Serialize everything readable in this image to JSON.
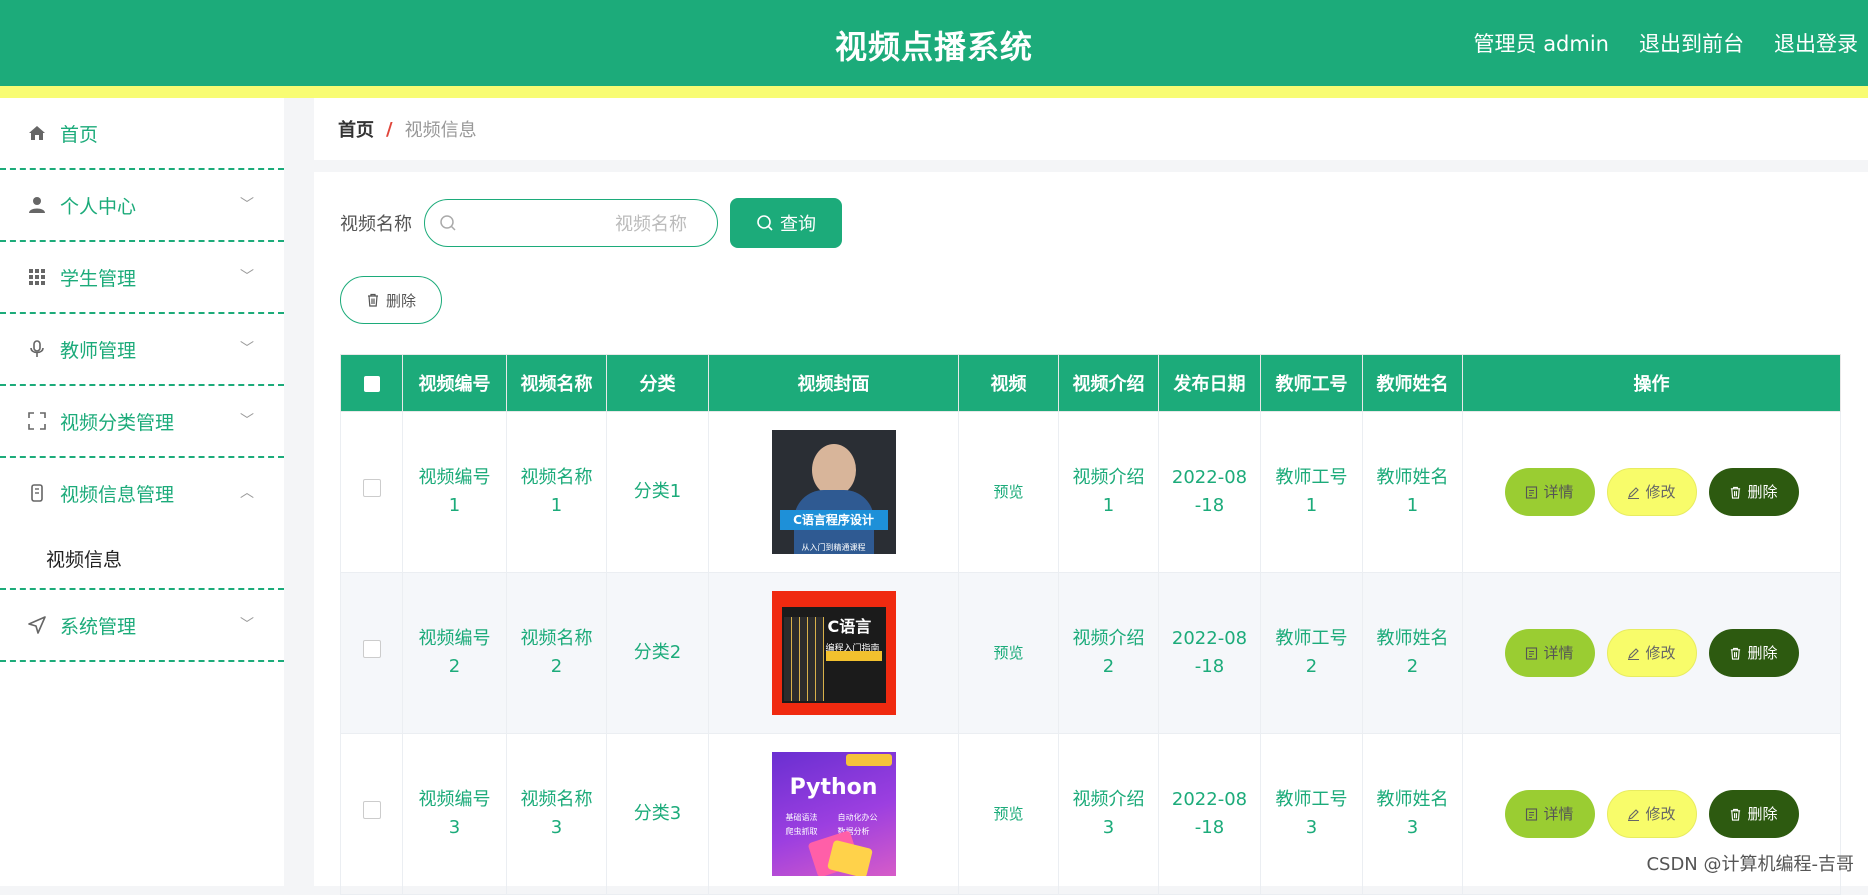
{
  "header": {
    "title": "视频点播系统",
    "user": "管理员 admin",
    "to_front": "退出到前台",
    "logout": "退出登录"
  },
  "sidebar": {
    "items": [
      {
        "label": "首页",
        "icon": "home-icon"
      },
      {
        "label": "个人中心",
        "icon": "user-icon"
      },
      {
        "label": "学生管理",
        "icon": "grid-icon"
      },
      {
        "label": "教师管理",
        "icon": "microphone-icon"
      },
      {
        "label": "视频分类管理",
        "icon": "fullscreen-icon"
      },
      {
        "label": "视频信息管理",
        "icon": "mobile-icon"
      },
      {
        "label": "系统管理",
        "icon": "navigation-icon"
      }
    ],
    "sub_item": "视频信息"
  },
  "breadcrumb": {
    "home": "首页",
    "separator": "/",
    "current": "视频信息"
  },
  "search": {
    "label": "视频名称",
    "placeholder": "视频名称",
    "query_button": "查询"
  },
  "toolbar": {
    "delete_label": "删除"
  },
  "table": {
    "headers": [
      "视频编号",
      "视频名称",
      "分类",
      "视频封面",
      "视频",
      "视频介绍",
      "发布日期",
      "教师工号",
      "教师姓名",
      "操作"
    ],
    "rows": [
      {
        "video_no_1": "视频编号",
        "video_no_2": "1",
        "video_name_1": "视频名称",
        "video_name_2": "1",
        "category": "分类1",
        "cover": {
          "line1": "C语言程序设计",
          "line2": "从入门到精通课程"
        },
        "video": "预览",
        "intro_1": "视频介绍",
        "intro_2": "1",
        "date_1": "2022-08",
        "date_2": "-18",
        "teacher_no_1": "教师工号",
        "teacher_no_2": "1",
        "teacher_name_1": "教师姓名",
        "teacher_name_2": "1"
      },
      {
        "video_no_1": "视频编号",
        "video_no_2": "2",
        "video_name_1": "视频名称",
        "video_name_2": "2",
        "category": "分类2",
        "cover": {
          "line1": "C语言",
          "line2": "编程入门指南"
        },
        "video": "预览",
        "intro_1": "视频介绍",
        "intro_2": "2",
        "date_1": "2022-08",
        "date_2": "-18",
        "teacher_no_1": "教师工号",
        "teacher_no_2": "2",
        "teacher_name_1": "教师姓名",
        "teacher_name_2": "2"
      },
      {
        "video_no_1": "视频编号",
        "video_no_2": "3",
        "video_name_1": "视频名称",
        "video_name_2": "3",
        "category": "分类3",
        "cover": {
          "line1": "Python",
          "f1": "基础语法",
          "f2": "自动化办公",
          "f3": "爬虫抓取",
          "f4": "数据分析"
        },
        "video": "预览",
        "intro_1": "视频介绍",
        "intro_2": "3",
        "date_1": "2022-08",
        "date_2": "-18",
        "teacher_no_1": "教师工号",
        "teacher_no_2": "3",
        "teacher_name_1": "教师姓名",
        "teacher_name_2": "3"
      }
    ],
    "actions": {
      "detail": "详情",
      "edit": "修改",
      "delete": "删除"
    }
  },
  "watermark": "CSDN @计算机编程-吉哥",
  "colors": {
    "primary": "#1cab7a",
    "accent_yellow": "#f8fc73",
    "detail_btn": "#9acd32",
    "delete_btn": "#2d5a10"
  }
}
